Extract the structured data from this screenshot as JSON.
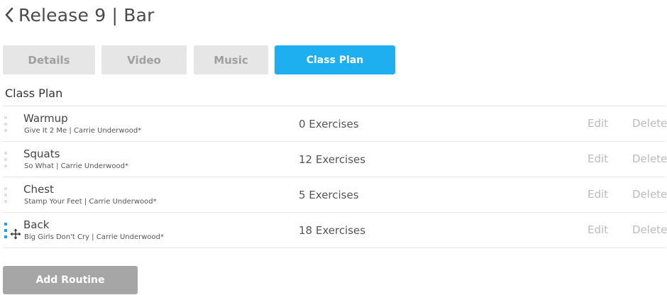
{
  "header": {
    "title": "Release 9 | Bar",
    "back_icon": "chevron-left-icon"
  },
  "tabs": [
    {
      "label": "Details",
      "active": false
    },
    {
      "label": "Video",
      "active": false
    },
    {
      "label": "Music",
      "active": false
    },
    {
      "label": "Class Plan",
      "active": true
    }
  ],
  "section": {
    "title": "Class Plan"
  },
  "routines": [
    {
      "name": "Warmup",
      "song": "Give It 2 Me | Carrie Underwood*",
      "exercises": "0 Exercises",
      "edit": "Edit",
      "delete": "Delete"
    },
    {
      "name": "Squats",
      "song": "So What | Carrie Underwood*",
      "exercises": "12 Exercises",
      "edit": "Edit",
      "delete": "Delete"
    },
    {
      "name": "Chest",
      "song": "Stamp Your Feet | Carrie Underwood*",
      "exercises": "5 Exercises",
      "edit": "Edit",
      "delete": "Delete"
    },
    {
      "name": "Back",
      "song": "Big Girls Don't Cry | Carrie Underwood*",
      "exercises": "18 Exercises",
      "edit": "Edit",
      "delete": "Delete"
    }
  ],
  "actions": {
    "add_routine": "Add Routine"
  },
  "colors": {
    "accent": "#1eaff0",
    "tab_bg": "#e6e6e6",
    "button_bg": "#a6a6a6",
    "drag_active": "#1f9ee0"
  }
}
